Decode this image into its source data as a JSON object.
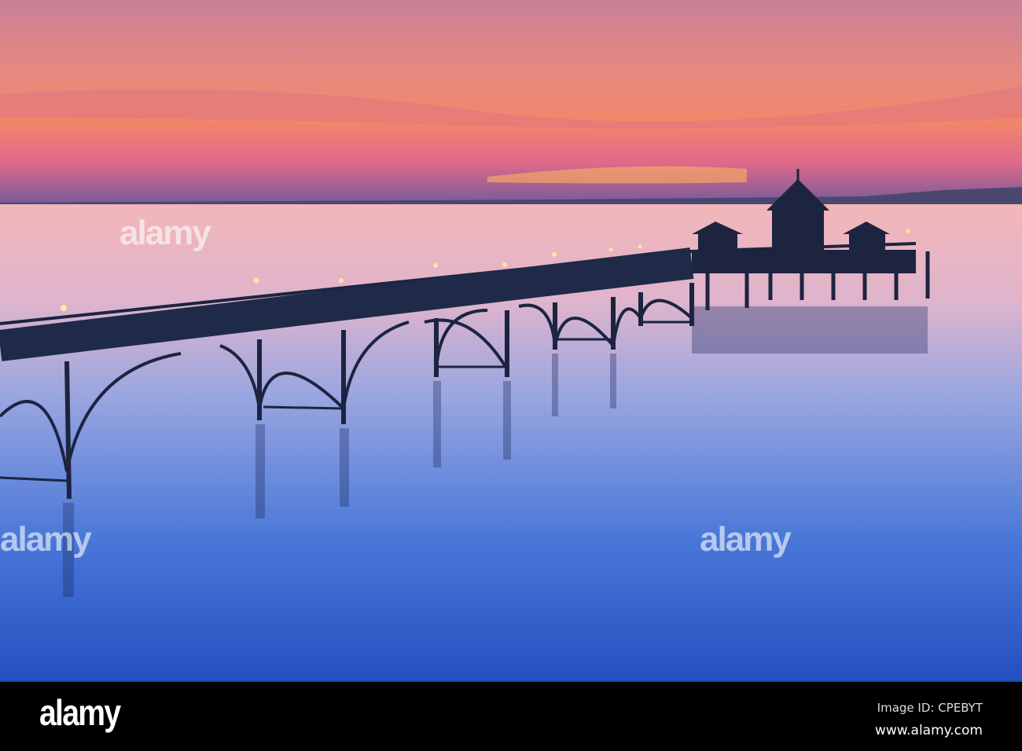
{
  "image": {
    "description_subject": "pier-at-sunset",
    "colors": {
      "sky_top": "#c87a9a",
      "sky_horizon": "#f07a5a",
      "sea_top": "#f0b0b8",
      "sea_bottom": "#2a5ad0",
      "silhouette": "#1a2440"
    }
  },
  "watermark": {
    "text": "alamy"
  },
  "footer": {
    "logo": "alamy",
    "image_id": "Image ID: CPEBYT",
    "website": "www.alamy.com"
  }
}
